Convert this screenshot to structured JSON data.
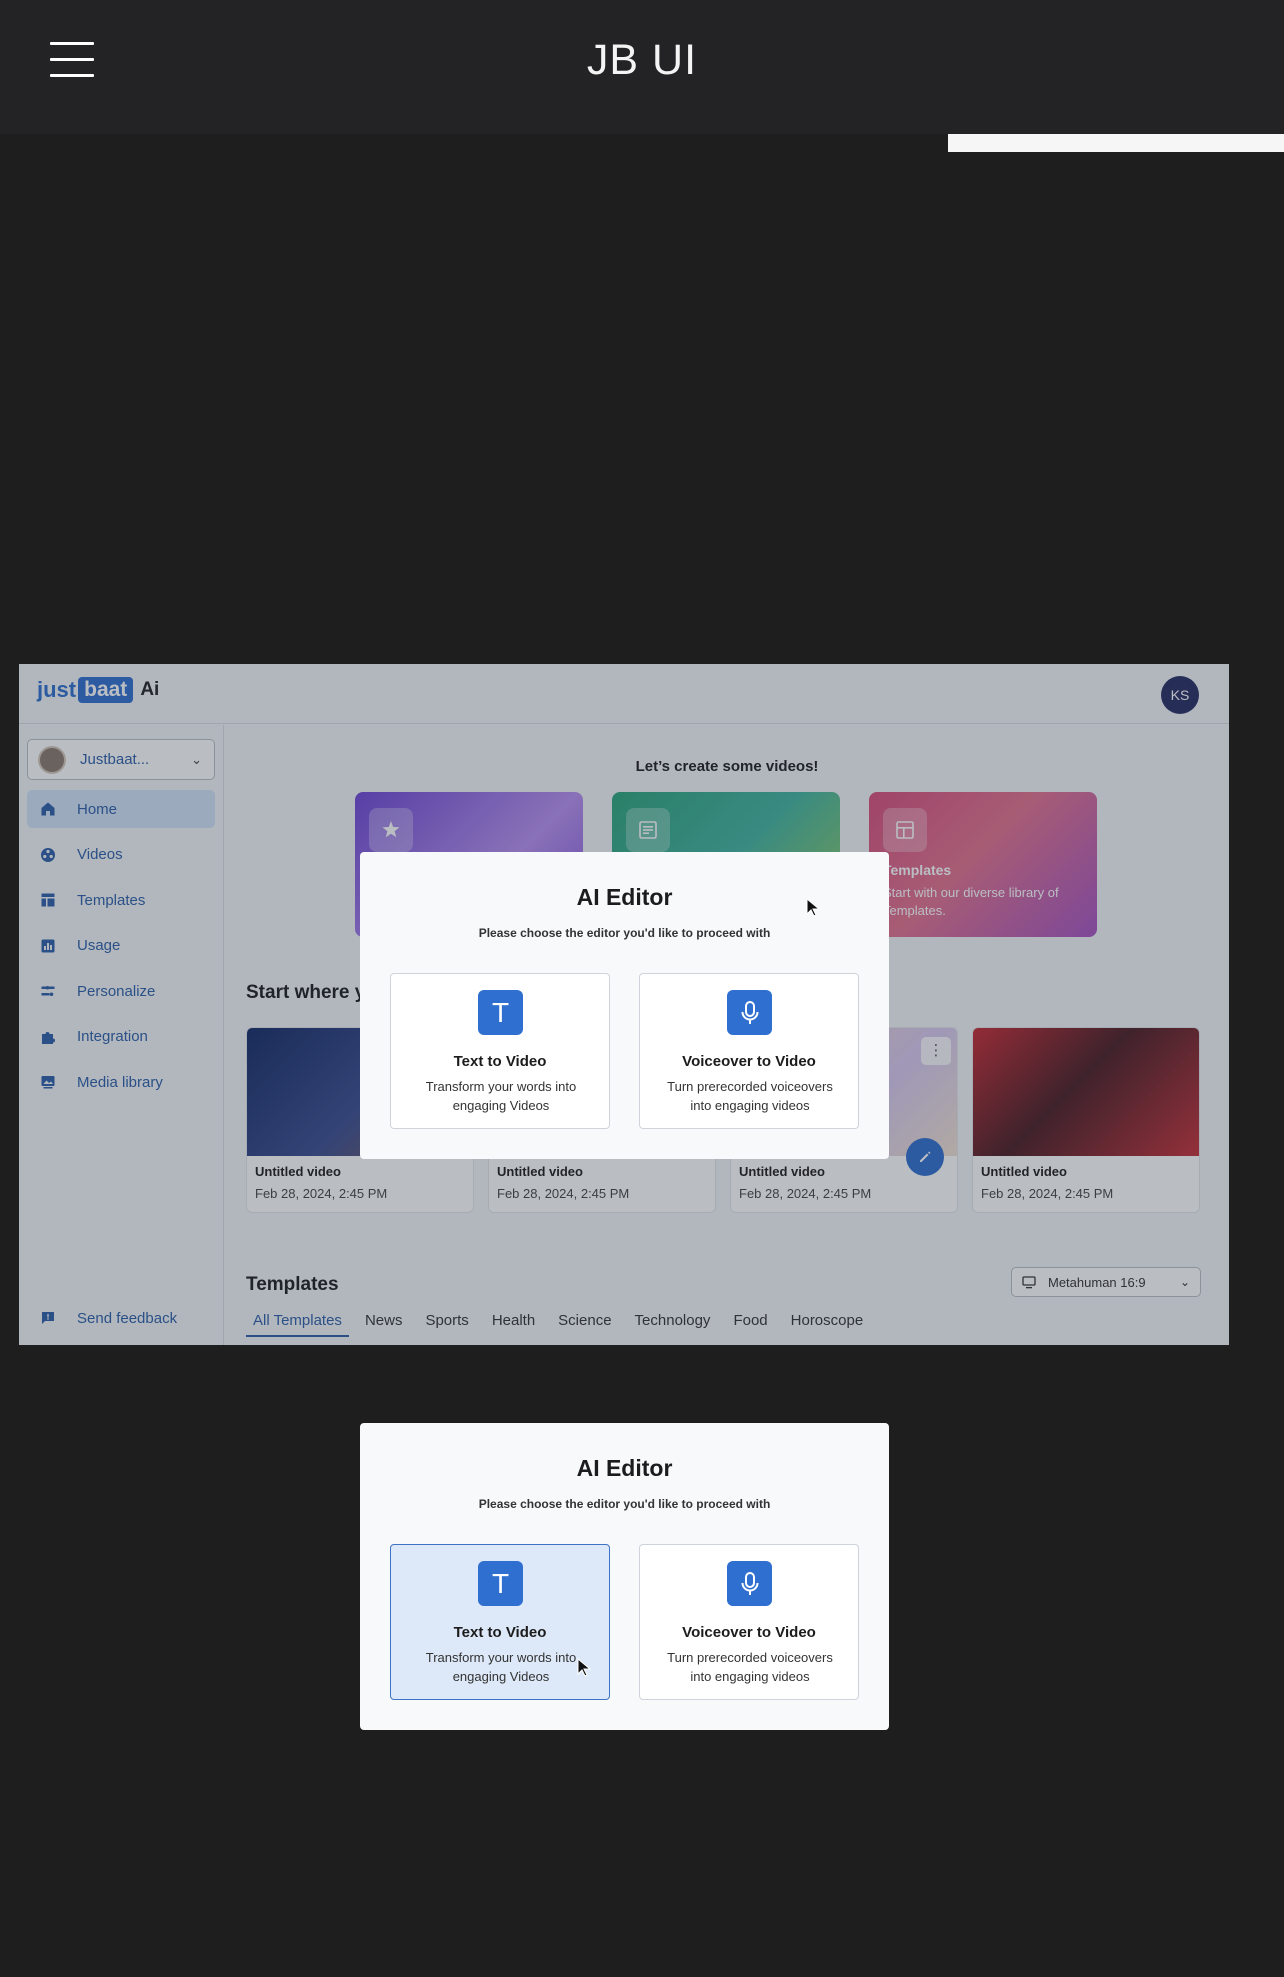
{
  "app": {
    "title": "JB UI"
  },
  "screen": {
    "logo": {
      "just": "just",
      "baat": "baat",
      "ai": "Ai"
    },
    "user_initials": "KS",
    "workspace": {
      "name": "Justbaat..."
    },
    "nav": [
      {
        "label": "Home",
        "icon": "home-icon",
        "active": true
      },
      {
        "label": "Videos",
        "icon": "videos-icon",
        "active": false
      },
      {
        "label": "Templates",
        "icon": "templates-icon",
        "active": false
      },
      {
        "label": "Usage",
        "icon": "usage-icon",
        "active": false
      },
      {
        "label": "Personalize",
        "icon": "personalize-icon",
        "active": false
      },
      {
        "label": "Integration",
        "icon": "integration-icon",
        "active": false
      },
      {
        "label": "Media library",
        "icon": "media-library-icon",
        "active": false
      }
    ],
    "feedback_label": "Send feedback",
    "heading": "Let’s create some videos!",
    "cards": [
      {
        "title": "",
        "desc": "",
        "icon": "magic-icon"
      },
      {
        "title": "",
        "desc": "",
        "icon": "document-icon"
      },
      {
        "title": "Templates",
        "desc": "Start with our diverse library of Templates.",
        "icon": "template-layout-icon"
      }
    ],
    "section_title": "Start where y",
    "videos": [
      {
        "name": "Untitled video",
        "date": "Feb 28, 2024, 2:45 PM"
      },
      {
        "name": "Untitled video",
        "date": "Feb 28, 2024, 2:45 PM"
      },
      {
        "name": "Untitled video",
        "date": "Feb 28, 2024, 2:45 PM"
      },
      {
        "name": "Untitled video",
        "date": "Feb 28, 2024, 2:45 PM"
      }
    ],
    "templates_title": "Templates",
    "ratio_select": "Metahuman 16:9",
    "tabs": [
      "All Templates",
      "News",
      "Sports",
      "Health",
      "Science",
      "Technology",
      "Food",
      "Horoscope"
    ],
    "active_tab": "All Templates"
  },
  "modal": {
    "title": "AI Editor",
    "subtitle": "Please choose the editor you'd like to proceed with",
    "options": [
      {
        "title": "Text to Video",
        "desc": "Transform your words into engaging Videos",
        "icon": "text-t-icon",
        "glyph": "T"
      },
      {
        "title": "Voiceover to Video",
        "desc": "Turn prerecorded voiceovers into engaging videos",
        "icon": "microphone-icon"
      }
    ]
  },
  "colors": {
    "accent": "#2f6fcf",
    "topbar": "#232325",
    "background": "#1e1e1f",
    "avatar": "#262d63"
  }
}
